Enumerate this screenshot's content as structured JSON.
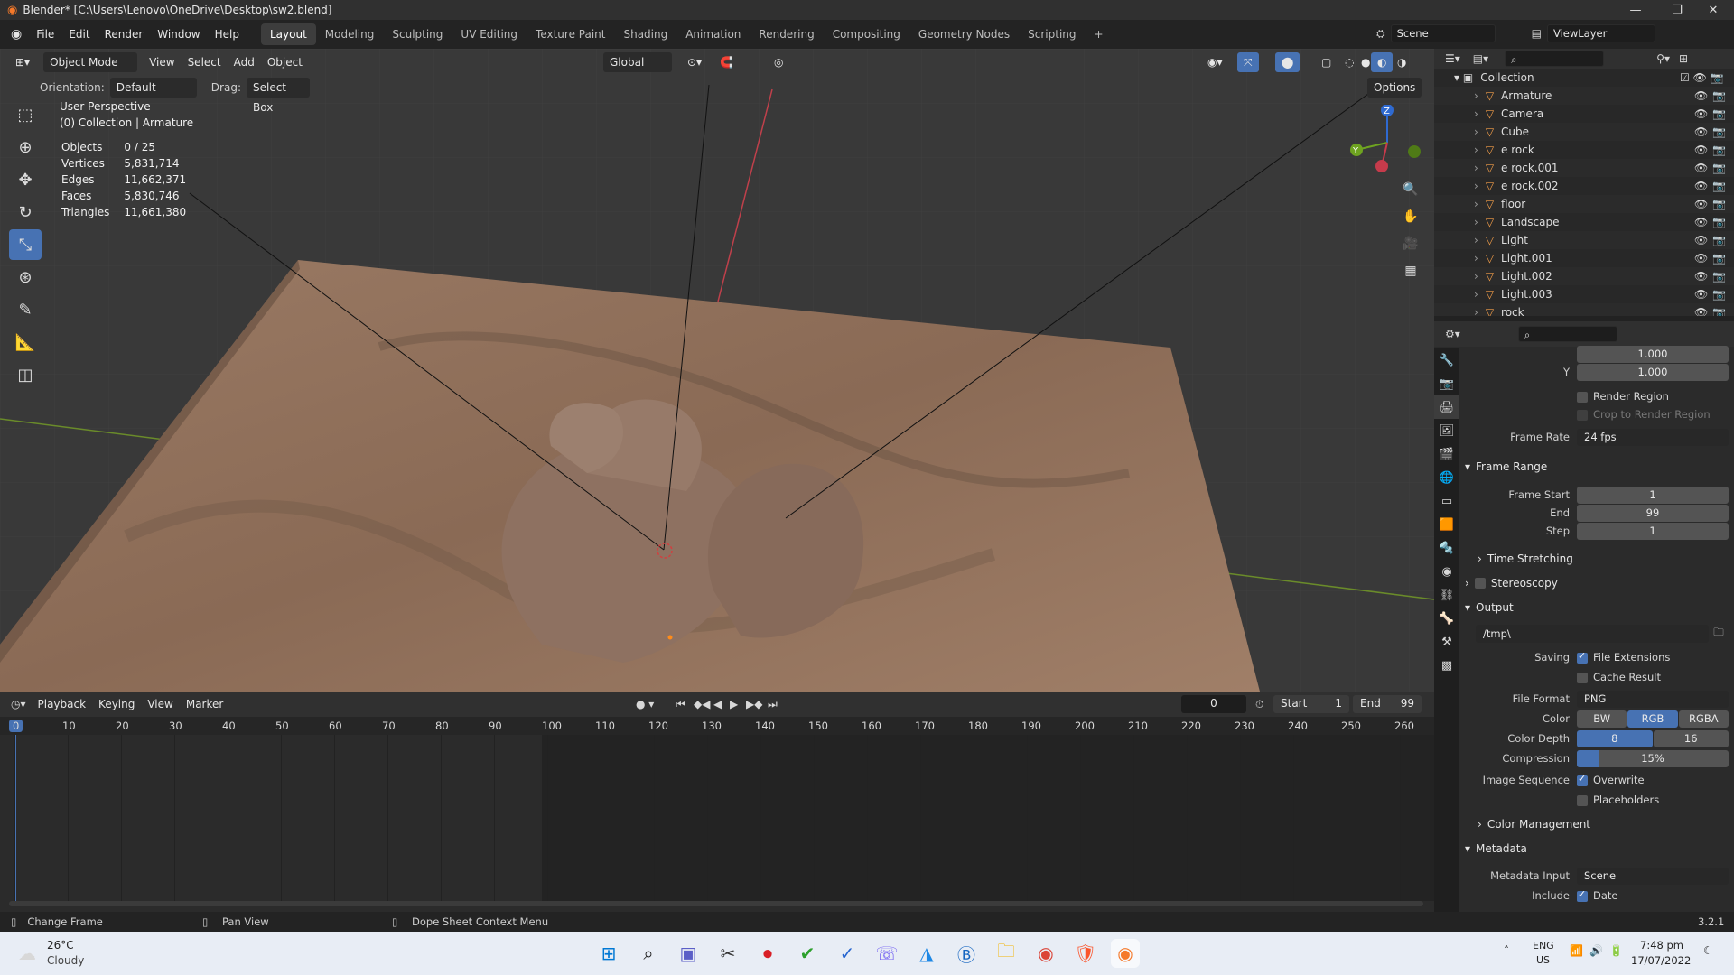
{
  "window": {
    "title": "Blender* [C:\\Users\\Lenovo\\OneDrive\\Desktop\\sw2.blend]",
    "controls": [
      "—",
      "❐",
      "✕"
    ]
  },
  "menu": [
    "File",
    "Edit",
    "Render",
    "Window",
    "Help"
  ],
  "workspaces": [
    "Layout",
    "Modeling",
    "Sculpting",
    "UV Editing",
    "Texture Paint",
    "Shading",
    "Animation",
    "Rendering",
    "Compositing",
    "Geometry Nodes",
    "Scripting",
    "+"
  ],
  "scene": {
    "label": "Scene",
    "viewlayer": "ViewLayer"
  },
  "viewport": {
    "mode": "Object Mode",
    "menus": [
      "View",
      "Select",
      "Add",
      "Object"
    ],
    "transform": "Global",
    "orientation_label": "Orientation:",
    "orientation": "Default",
    "drag_label": "Drag:",
    "drag": "Select Box",
    "options": "Options",
    "overlay_title": "User Perspective",
    "overlay_sub": "(0) Collection | Armature",
    "stats": [
      {
        "k": "Objects",
        "v": "0 / 25"
      },
      {
        "k": "Vertices",
        "v": "5,831,714"
      },
      {
        "k": "Edges",
        "v": "11,662,371"
      },
      {
        "k": "Faces",
        "v": "5,830,746"
      },
      {
        "k": "Triangles",
        "v": "11,661,380"
      }
    ],
    "gizmo": {
      "z": "Z",
      "y": "Y"
    }
  },
  "outliner": {
    "root": "Collection",
    "items": [
      "Armature",
      "Camera",
      "Cube",
      "e rock",
      "e rock.001",
      "e rock.002",
      "floor",
      "Landscape",
      "Light",
      "Light.001",
      "Light.002",
      "Light.003",
      "rock"
    ]
  },
  "properties": {
    "aspect_y_label": "Y",
    "aspect_x": "1.000",
    "aspect_y": "1.000",
    "render_region": "Render Region",
    "crop_region": "Crop to Render Region",
    "frame_rate_label": "Frame Rate",
    "frame_rate": "24 fps",
    "frame_range": "Frame Range",
    "frame_start_label": "Frame Start",
    "frame_start": "1",
    "end_label": "End",
    "end": "99",
    "step_label": "Step",
    "step": "1",
    "time_stretching": "Time Stretching",
    "stereoscopy": "Stereoscopy",
    "output": "Output",
    "output_path": "/tmp\\",
    "saving_label": "Saving",
    "file_extensions": "File Extensions",
    "cache_result": "Cache Result",
    "file_format_label": "File Format",
    "file_format": "PNG",
    "color_label": "Color",
    "color_opts": [
      "BW",
      "RGB",
      "RGBA"
    ],
    "color_depth_label": "Color Depth",
    "color_depth": [
      "8",
      "16"
    ],
    "compression_label": "Compression",
    "compression": "15%",
    "compression_fraction": 0.15,
    "image_seq_label": "Image Sequence",
    "overwrite": "Overwrite",
    "placeholders": "Placeholders",
    "color_management": "Color Management",
    "metadata": "Metadata",
    "metadata_input_label": "Metadata Input",
    "metadata_input": "Scene",
    "include_label": "Include",
    "date": "Date"
  },
  "timeline": {
    "menus": [
      "Playback",
      "Keying",
      "View",
      "Marker"
    ],
    "current": "0",
    "start_label": "Start",
    "start": "1",
    "end_label": "End",
    "end": "99",
    "ticks": [
      "0",
      "10",
      "20",
      "30",
      "40",
      "50",
      "60",
      "70",
      "80",
      "90",
      "100",
      "110",
      "120",
      "130",
      "140",
      "150",
      "160",
      "170",
      "180",
      "190",
      "200",
      "210",
      "220",
      "230",
      "240",
      "250",
      "260"
    ]
  },
  "status": {
    "items": [
      "Change Frame",
      "Pan View",
      "Dope Sheet Context Menu"
    ],
    "version": "3.2.1"
  },
  "taskbar": {
    "temp": "26°C",
    "weather": "Cloudy",
    "lang1": "ENG",
    "lang2": "US",
    "time": "7:48 pm",
    "date": "17/07/2022"
  },
  "colors": {
    "accent": "#4772b3",
    "viewport": "#393939",
    "panel": "#2b2b2b"
  }
}
